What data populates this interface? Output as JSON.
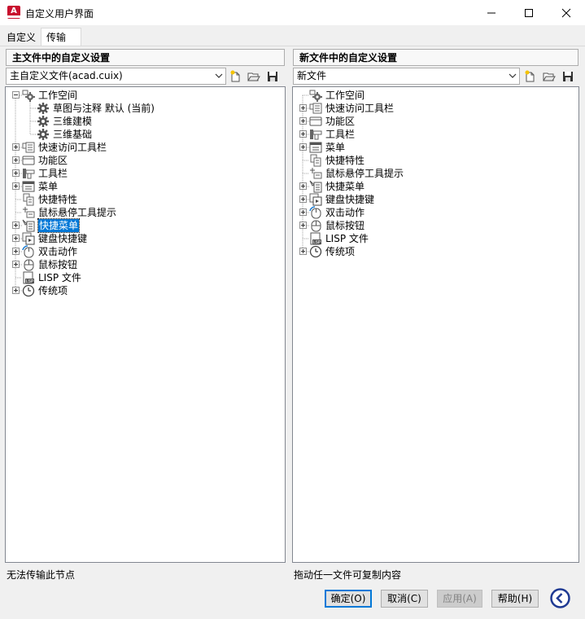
{
  "window": {
    "title": "自定义用户界面",
    "app_icon_letter": "A",
    "minimize_glyph": "—",
    "maximize_glyph": "☐",
    "close_glyph": "✕"
  },
  "tabs": [
    {
      "label": "自定义",
      "active": false
    },
    {
      "label": "传输",
      "active": true
    }
  ],
  "left_panel": {
    "header": "主文件中的自定义设置",
    "combo_value": "主自定义文件(acad.cuix)",
    "status": "无法传输此节点",
    "tree": [
      {
        "label": "工作空间",
        "icon": "workspace-gear-icon",
        "expander": "minus",
        "level": 0
      },
      {
        "label": "草图与注释 默认 (当前)",
        "icon": "gear-icon",
        "expander": "",
        "level": 1
      },
      {
        "label": "三维建模",
        "icon": "gear-icon",
        "expander": "",
        "level": 1
      },
      {
        "label": "三维基础",
        "icon": "gear-icon",
        "expander": "",
        "level": 1
      },
      {
        "label": "快速访问工具栏",
        "icon": "quick-access-toolbar-icon",
        "expander": "plus",
        "level": 0
      },
      {
        "label": "功能区",
        "icon": "ribbon-icon",
        "expander": "plus",
        "level": 0
      },
      {
        "label": "工具栏",
        "icon": "toolbar-icon",
        "expander": "plus",
        "level": 0
      },
      {
        "label": "菜单",
        "icon": "menu-icon",
        "expander": "plus",
        "level": 0
      },
      {
        "label": "快捷特性",
        "icon": "quick-properties-icon",
        "expander": "",
        "level": 0
      },
      {
        "label": "鼠标悬停工具提示",
        "icon": "rollover-tooltip-icon",
        "expander": "",
        "level": 0
      },
      {
        "label": "快捷菜单",
        "icon": "shortcut-menu-icon",
        "expander": "plus",
        "level": 0,
        "selected": true
      },
      {
        "label": "键盘快捷键",
        "icon": "keyboard-shortcut-icon",
        "expander": "plus",
        "level": 0
      },
      {
        "label": "双击动作",
        "icon": "double-click-icon",
        "expander": "plus",
        "level": 0
      },
      {
        "label": "鼠标按钮",
        "icon": "mouse-button-icon",
        "expander": "plus",
        "level": 0
      },
      {
        "label": "LISP 文件",
        "icon": "lisp-file-icon",
        "expander": "",
        "level": 0
      },
      {
        "label": "传统项",
        "icon": "legacy-clock-icon",
        "expander": "plus",
        "level": 0
      }
    ]
  },
  "right_panel": {
    "header": "新文件中的自定义设置",
    "combo_value": "新文件",
    "status": "拖动任一文件可复制内容",
    "tree": [
      {
        "label": "工作空间",
        "icon": "workspace-gear-icon",
        "expander": "",
        "level": 0
      },
      {
        "label": "快速访问工具栏",
        "icon": "quick-access-toolbar-icon",
        "expander": "plus",
        "level": 0
      },
      {
        "label": "功能区",
        "icon": "ribbon-icon",
        "expander": "plus",
        "level": 0
      },
      {
        "label": "工具栏",
        "icon": "toolbar-icon",
        "expander": "plus",
        "level": 0
      },
      {
        "label": "菜单",
        "icon": "menu-icon",
        "expander": "plus",
        "level": 0
      },
      {
        "label": "快捷特性",
        "icon": "quick-properties-icon",
        "expander": "",
        "level": 0
      },
      {
        "label": "鼠标悬停工具提示",
        "icon": "rollover-tooltip-icon",
        "expander": "",
        "level": 0
      },
      {
        "label": "快捷菜单",
        "icon": "shortcut-menu-icon",
        "expander": "plus",
        "level": 0
      },
      {
        "label": "键盘快捷键",
        "icon": "keyboard-shortcut-icon",
        "expander": "plus",
        "level": 0
      },
      {
        "label": "双击动作",
        "icon": "double-click-icon",
        "expander": "plus",
        "level": 0
      },
      {
        "label": "鼠标按钮",
        "icon": "mouse-button-icon",
        "expander": "plus",
        "level": 0
      },
      {
        "label": "LISP 文件",
        "icon": "lisp-file-icon",
        "expander": "",
        "level": 0
      },
      {
        "label": "传统项",
        "icon": "legacy-clock-icon",
        "expander": "plus",
        "level": 0
      }
    ]
  },
  "buttons": {
    "ok": "确定(O)",
    "cancel": "取消(C)",
    "apply": "应用(A)",
    "help": "帮助(H)"
  },
  "colors": {
    "selection": "#0078d7",
    "app_icon": "#c8102e",
    "help_circle": "#1f3a93"
  }
}
